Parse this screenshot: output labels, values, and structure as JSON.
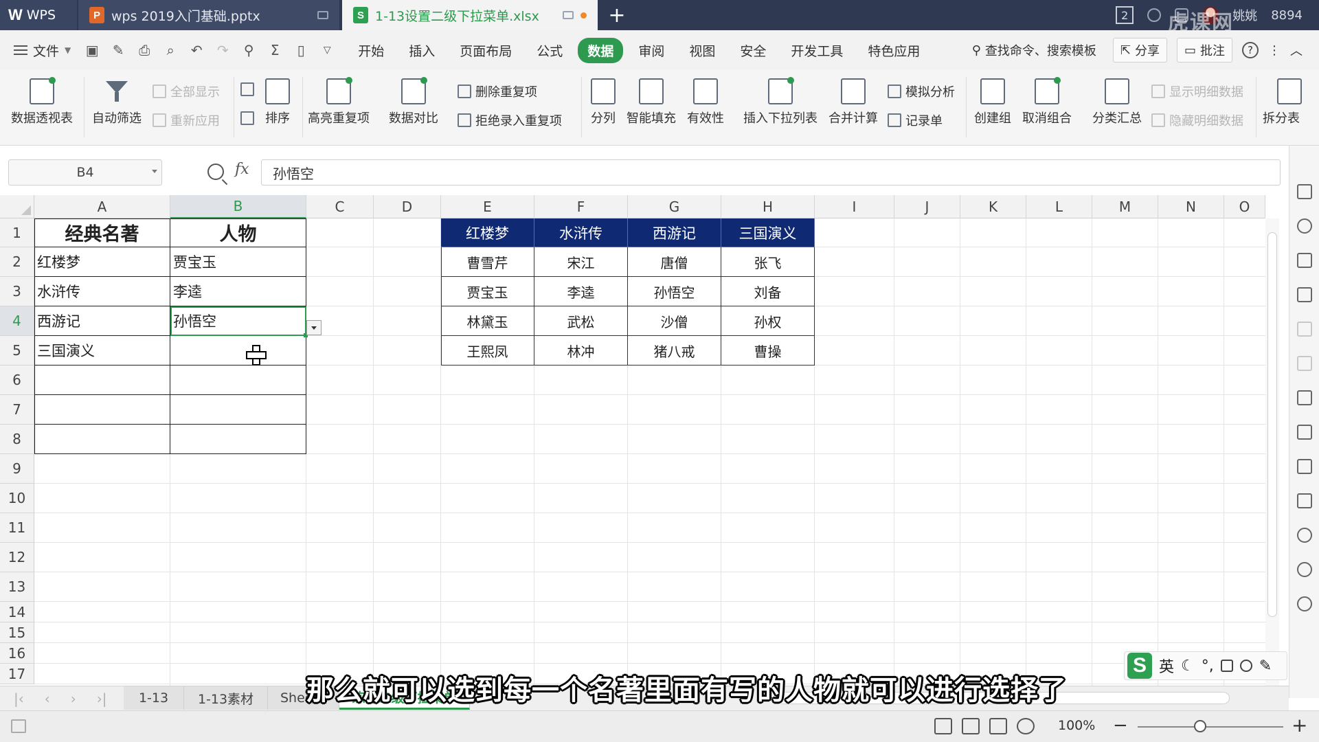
{
  "title_bar": {
    "home_label": "WPS",
    "tabs": [
      {
        "label": "wps 2019入门基础.pptx",
        "badge": "P"
      },
      {
        "label": "1-13设置二级下拉菜单.xlsx",
        "badge": "S"
      }
    ],
    "window_count": "2",
    "user_name": "姚姚",
    "user_id_partial": "8894",
    "watermark": "虎课网"
  },
  "menu_bar": {
    "file_label": "文件",
    "tabs": [
      "开始",
      "插入",
      "页面布局",
      "公式",
      "数据",
      "审阅",
      "视图",
      "安全",
      "开发工具",
      "特色应用"
    ],
    "active_tab": "数据",
    "search_label": "查找命令、搜索模板",
    "share_label": "分享",
    "comment_label": "批注"
  },
  "ribbon": {
    "pivot": "数据透视表",
    "autofilter": "自动筛选",
    "show_all": "全部显示",
    "reapply": "重新应用",
    "sort": "排序",
    "highlight_dup": "高亮重复项",
    "data_compare": "数据对比",
    "remove_dup": "删除重复项",
    "reject_dup": "拒绝录入重复项",
    "split_col": "分列",
    "smart_fill": "智能填充",
    "validity": "有效性",
    "insert_dropdown": "插入下拉列表",
    "merge_calc": "合并计算",
    "what_if": "模拟分析",
    "record_form": "记录单",
    "create_group": "创建组",
    "ungroup": "取消组合",
    "subtotal": "分类汇总",
    "show_detail": "显示明细数据",
    "hide_detail": "隐藏明细数据",
    "split_table": "拆分表"
  },
  "formula_bar": {
    "cell_ref": "B4",
    "fx": "fx",
    "content": "孙悟空"
  },
  "columns": [
    "A",
    "B",
    "C",
    "D",
    "E",
    "F",
    "G",
    "H",
    "I",
    "J",
    "K",
    "L",
    "M",
    "N",
    "O"
  ],
  "selected_column": "B",
  "rows": [
    "1",
    "2",
    "3",
    "4",
    "5",
    "6",
    "7",
    "8",
    "9",
    "10",
    "11",
    "12",
    "13",
    "14",
    "15",
    "16",
    "17"
  ],
  "selected_row": "4",
  "table1": {
    "headers": [
      "经典名著",
      "人物"
    ],
    "rows": [
      [
        "红楼梦",
        "贾宝玉"
      ],
      [
        "水浒传",
        "李逵"
      ],
      [
        "西游记",
        "孙悟空"
      ],
      [
        "三国演义",
        ""
      ],
      [
        "",
        ""
      ],
      [
        "",
        ""
      ],
      [
        "",
        ""
      ]
    ]
  },
  "table2": {
    "headers": [
      "红楼梦",
      "水浒传",
      "西游记",
      "三国演义"
    ],
    "rows": [
      [
        "曹雪芹",
        "宋江",
        "唐僧",
        "张飞"
      ],
      [
        "贾宝玉",
        "李逵",
        "孙悟空",
        "刘备"
      ],
      [
        "林黛玉",
        "武松",
        "沙僧",
        "孙权"
      ],
      [
        "王熙凤",
        "林冲",
        "猪八戒",
        "曹操"
      ]
    ],
    "header_bg": "#0f2a73"
  },
  "sheet_tabs": [
    "1-13",
    "1-13素材",
    "Sheet1",
    "练习二级下拉菜单"
  ],
  "active_sheet": "练习二级下拉菜单",
  "status_bar": {
    "zoom": "100%",
    "zoom_fraction": 0.43
  },
  "ime": {
    "lang": "英"
  },
  "subtitle": "那么就可以选到每一个名著里面有写的人物就可以进行选择了",
  "colors": {
    "accent": "#2e9a50",
    "titlebar": "#2f3a52",
    "ppt_badge": "#e2682a",
    "xls_badge": "#2ea052"
  }
}
